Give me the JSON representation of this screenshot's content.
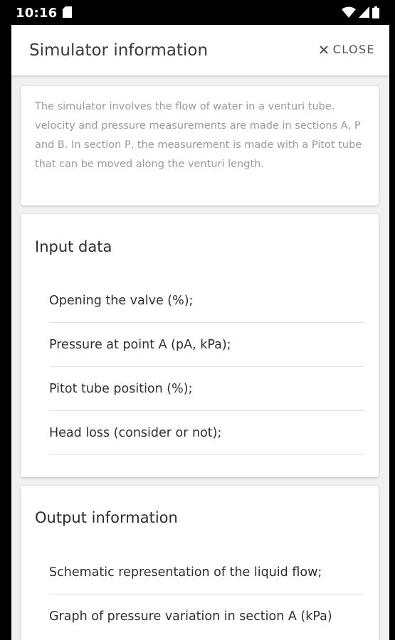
{
  "status_bar": {
    "time": "10:16",
    "icons": [
      "sd-card-icon",
      "wifi-icon",
      "signal-icon",
      "battery-icon"
    ]
  },
  "dialog": {
    "title": "Simulator information",
    "close_label": "CLOSE"
  },
  "intro": {
    "text": "The simulator involves the flow of water in a venturi tube. velocity and pressure measurements are made in sections A, P and B. In section P, the measurement is made with a Pitot tube that can be moved along the venturi length."
  },
  "input_section": {
    "title": "Input data",
    "items": [
      "Opening the valve (%);",
      "Pressure at point A (pA, kPa);",
      "Pitot tube position (%);",
      "Head loss (consider or not);"
    ]
  },
  "output_section": {
    "title": "Output information",
    "items": [
      "Schematic representation of the liquid flow;",
      "Graph of pressure variation in section A (kPa)"
    ]
  },
  "colors": {
    "status_bar": "#000000",
    "backdrop": "#f1f1f1",
    "card": "#ffffff",
    "muted_text": "#9a9a9a"
  }
}
